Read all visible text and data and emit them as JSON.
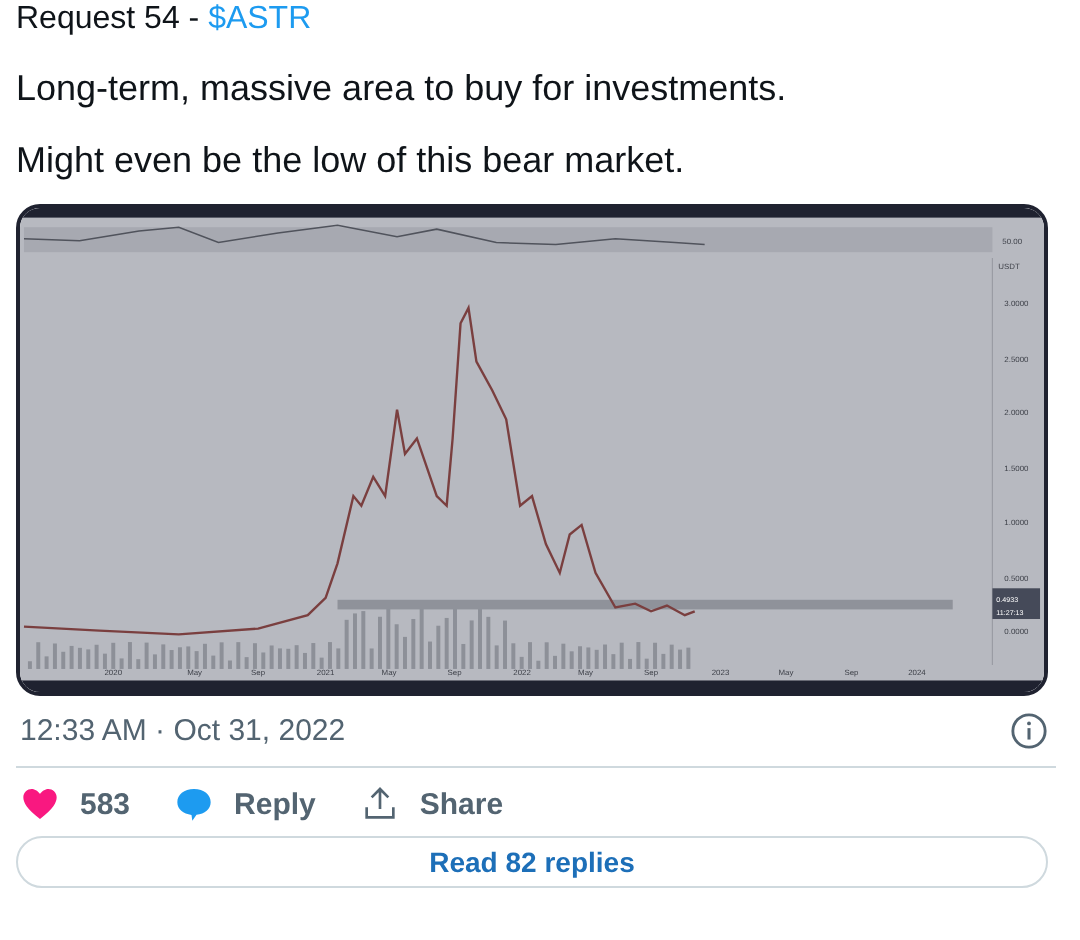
{
  "tweet": {
    "lead_text": "Request 54 -",
    "lead_tag": "$ASTR",
    "paragraphs": [
      "Long-term, massive area to buy for investments.",
      "Might even be the low of this bear market."
    ]
  },
  "chart_image": {
    "y_labels": [
      "3.0000",
      "2.5000",
      "2.0000",
      "1.5000",
      "1.0000",
      "0.5000",
      "0.0000"
    ],
    "x_labels": [
      "2020",
      "May",
      "Sep",
      "2021",
      "May",
      "Sep",
      "2022",
      "May",
      "Sep",
      "2023",
      "May",
      "Sep",
      "2024"
    ],
    "rsi_label": "50.00",
    "currency": "USDT",
    "price_tag": "0.4933",
    "countdown": "11:27:13"
  },
  "timestamp": "12:33 AM · Oct 31, 2022",
  "actions": [
    {
      "kind": "like",
      "label": "583"
    },
    {
      "kind": "reply",
      "label": "Reply"
    },
    {
      "kind": "share",
      "label": "Share"
    }
  ],
  "replies_button": "Read 82 replies"
}
